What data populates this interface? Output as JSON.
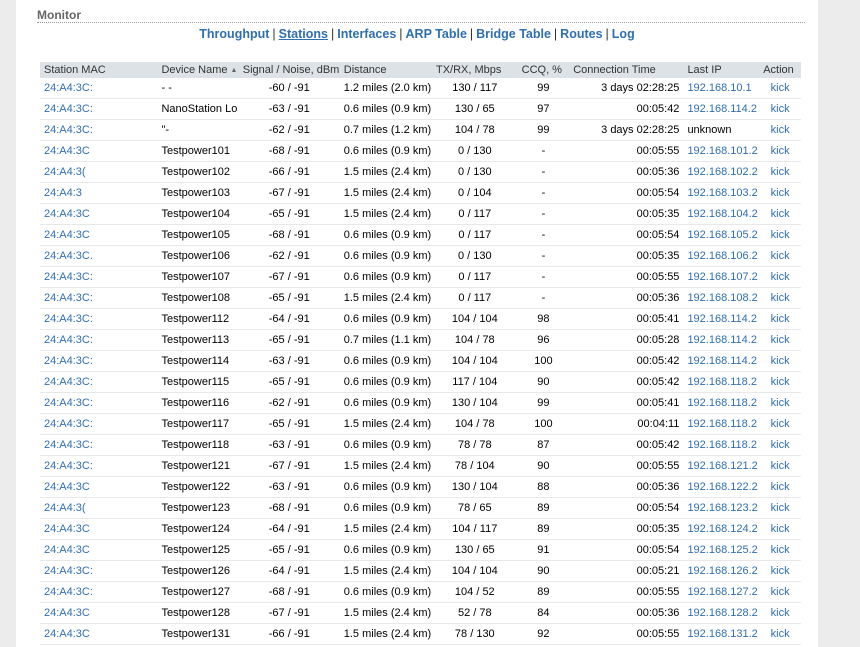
{
  "page": {
    "title": "Monitor"
  },
  "nav": [
    {
      "label": "Throughput",
      "active": false
    },
    {
      "label": "Stations",
      "active": true
    },
    {
      "label": "Interfaces",
      "active": false
    },
    {
      "label": "ARP Table",
      "active": false
    },
    {
      "label": "Bridge Table",
      "active": false
    },
    {
      "label": "Routes",
      "active": false
    },
    {
      "label": "Log",
      "active": false
    }
  ],
  "table": {
    "headers": {
      "mac": "Station MAC",
      "name": "Device Name",
      "signal": "Signal / Noise, dBm",
      "distance": "Distance",
      "txrx": "TX/RX, Mbps",
      "ccq": "CCQ, %",
      "time": "Connection Time",
      "ip": "Last IP",
      "action": "Action"
    },
    "sort_indicator": "▲",
    "rows": [
      {
        "mac": "24:A4:3C:",
        "name": "-      -",
        "signal": "-60 / -91",
        "distance": "1.2 miles (2.0 km)",
        "txrx": "130 / 117",
        "ccq": "99",
        "time": "3 days 02:28:25",
        "ip": "192.168.10.1",
        "ip_link": true,
        "action": "kick"
      },
      {
        "mac": "24:A4:3C:",
        "name": "NanoStation Lo",
        "signal": "-63 / -91",
        "distance": "0.6 miles (0.9 km)",
        "txrx": "130 / 65",
        "ccq": "97",
        "time": "00:05:42",
        "ip": "192.168.114.2",
        "ip_link": true,
        "action": "kick"
      },
      {
        "mac": "24:A4:3C:",
        "name": "\"-",
        "signal": "-62 / -91",
        "distance": "0.7 miles (1.2 km)",
        "txrx": "104 / 78",
        "ccq": "99",
        "time": "3 days 02:28:25",
        "ip": "unknown",
        "ip_link": false,
        "action": "kick"
      },
      {
        "mac": "24:A4:3C",
        "name": "Testpower101",
        "signal": "-68 / -91",
        "distance": "0.6 miles (0.9 km)",
        "txrx": "0 / 130",
        "ccq": "-",
        "time": "00:05:55",
        "ip": "192.168.101.2",
        "ip_link": true,
        "action": "kick"
      },
      {
        "mac": "24:A4:3(",
        "name": "Testpower102",
        "signal": "-66 / -91",
        "distance": "1.5 miles (2.4 km)",
        "txrx": "0 / 130",
        "ccq": "-",
        "time": "00:05:36",
        "ip": "192.168.102.2",
        "ip_link": true,
        "action": "kick"
      },
      {
        "mac": "24:A4:3",
        "name": "Testpower103",
        "signal": "-67 / -91",
        "distance": "1.5 miles (2.4 km)",
        "txrx": "0 / 104",
        "ccq": "-",
        "time": "00:05:54",
        "ip": "192.168.103.2",
        "ip_link": true,
        "action": "kick"
      },
      {
        "mac": "24:A4:3C",
        "name": "Testpower104",
        "signal": "-65 / -91",
        "distance": "1.5 miles (2.4 km)",
        "txrx": "0 / 117",
        "ccq": "-",
        "time": "00:05:35",
        "ip": "192.168.104.2",
        "ip_link": true,
        "action": "kick"
      },
      {
        "mac": "24:A4:3C",
        "name": "Testpower105",
        "signal": "-68 / -91",
        "distance": "0.6 miles (0.9 km)",
        "txrx": "0 / 117",
        "ccq": "-",
        "time": "00:05:54",
        "ip": "192.168.105.2",
        "ip_link": true,
        "action": "kick"
      },
      {
        "mac": "24:A4:3C.",
        "name": "Testpower106",
        "signal": "-62 / -91",
        "distance": "0.6 miles (0.9 km)",
        "txrx": "0 / 130",
        "ccq": "-",
        "time": "00:05:35",
        "ip": "192.168.106.2",
        "ip_link": true,
        "action": "kick"
      },
      {
        "mac": "24:A4:3C:",
        "name": "Testpower107",
        "signal": "-67 / -91",
        "distance": "0.6 miles (0.9 km)",
        "txrx": "0 / 117",
        "ccq": "-",
        "time": "00:05:55",
        "ip": "192.168.107.2",
        "ip_link": true,
        "action": "kick"
      },
      {
        "mac": "24:A4:3C:",
        "name": "Testpower108",
        "signal": "-65 / -91",
        "distance": "1.5 miles (2.4 km)",
        "txrx": "0 / 117",
        "ccq": "-",
        "time": "00:05:36",
        "ip": "192.168.108.2",
        "ip_link": true,
        "action": "kick"
      },
      {
        "mac": "24:A4:3C:",
        "name": "Testpower112",
        "signal": "-64 / -91",
        "distance": "0.6 miles (0.9 km)",
        "txrx": "104 / 104",
        "ccq": "98",
        "time": "00:05:41",
        "ip": "192.168.114.2",
        "ip_link": true,
        "action": "kick"
      },
      {
        "mac": "24:A4:3C:",
        "name": "Testpower113",
        "signal": "-65 / -91",
        "distance": "0.7 miles (1.1 km)",
        "txrx": "104 / 78",
        "ccq": "96",
        "time": "00:05:28",
        "ip": "192.168.114.2",
        "ip_link": true,
        "action": "kick"
      },
      {
        "mac": "24:A4:3C:",
        "name": "Testpower114",
        "signal": "-63 / -91",
        "distance": "0.6 miles (0.9 km)",
        "txrx": "104 / 104",
        "ccq": "100",
        "time": "00:05:42",
        "ip": "192.168.114.2",
        "ip_link": true,
        "action": "kick"
      },
      {
        "mac": "24:A4:3C:",
        "name": "Testpower115",
        "signal": "-65 / -91",
        "distance": "0.6 miles (0.9 km)",
        "txrx": "117 / 104",
        "ccq": "90",
        "time": "00:05:42",
        "ip": "192.168.118.2",
        "ip_link": true,
        "action": "kick"
      },
      {
        "mac": "24:A4:3C:",
        "name": "Testpower116",
        "signal": "-62 / -91",
        "distance": "0.6 miles (0.9 km)",
        "txrx": "130 / 104",
        "ccq": "99",
        "time": "00:05:41",
        "ip": "192.168.118.2",
        "ip_link": true,
        "action": "kick"
      },
      {
        "mac": "24:A4:3C:",
        "name": "Testpower117",
        "signal": "-65 / -91",
        "distance": "1.5 miles (2.4 km)",
        "txrx": "104 / 78",
        "ccq": "100",
        "time": "00:04:11",
        "ip": "192.168.118.2",
        "ip_link": true,
        "action": "kick"
      },
      {
        "mac": "24:A4:3C:",
        "name": "Testpower118",
        "signal": "-63 / -91",
        "distance": "0.6 miles (0.9 km)",
        "txrx": "78 / 78",
        "ccq": "87",
        "time": "00:05:42",
        "ip": "192.168.118.2",
        "ip_link": true,
        "action": "kick"
      },
      {
        "mac": "24:A4:3C:",
        "name": "Testpower121",
        "signal": "-67 / -91",
        "distance": "1.5 miles (2.4 km)",
        "txrx": "78 / 104",
        "ccq": "90",
        "time": "00:05:55",
        "ip": "192.168.121.2",
        "ip_link": true,
        "action": "kick"
      },
      {
        "mac": "24:A4:3C",
        "name": "Testpower122",
        "signal": "-63 / -91",
        "distance": "0.6 miles (0.9 km)",
        "txrx": "130 / 104",
        "ccq": "88",
        "time": "00:05:36",
        "ip": "192.168.122.2",
        "ip_link": true,
        "action": "kick"
      },
      {
        "mac": "24:A4:3(",
        "name": "Testpower123",
        "signal": "-68 / -91",
        "distance": "0.6 miles (0.9 km)",
        "txrx": "78 / 65",
        "ccq": "89",
        "time": "00:05:54",
        "ip": "192.168.123.2",
        "ip_link": true,
        "action": "kick"
      },
      {
        "mac": "24:A4:3C",
        "name": "Testpower124",
        "signal": "-64 / -91",
        "distance": "1.5 miles (2.4 km)",
        "txrx": "104 / 117",
        "ccq": "89",
        "time": "00:05:35",
        "ip": "192.168.124.2",
        "ip_link": true,
        "action": "kick"
      },
      {
        "mac": "24:A4:3C",
        "name": "Testpower125",
        "signal": "-65 / -91",
        "distance": "0.6 miles (0.9 km)",
        "txrx": "130 / 65",
        "ccq": "91",
        "time": "00:05:54",
        "ip": "192.168.125.2",
        "ip_link": true,
        "action": "kick"
      },
      {
        "mac": "24:A4:3C:",
        "name": "Testpower126",
        "signal": "-64 / -91",
        "distance": "1.5 miles (2.4 km)",
        "txrx": "104 / 104",
        "ccq": "90",
        "time": "00:05:21",
        "ip": "192.168.126.2",
        "ip_link": true,
        "action": "kick"
      },
      {
        "mac": "24:A4:3C:",
        "name": "Testpower127",
        "signal": "-68 / -91",
        "distance": "0.6 miles (0.9 km)",
        "txrx": "104 / 52",
        "ccq": "89",
        "time": "00:05:55",
        "ip": "192.168.127.2",
        "ip_link": true,
        "action": "kick"
      },
      {
        "mac": "24:A4:3C",
        "name": "Testpower128",
        "signal": "-67 / -91",
        "distance": "1.5 miles (2.4 km)",
        "txrx": "52 / 78",
        "ccq": "84",
        "time": "00:05:36",
        "ip": "192.168.128.2",
        "ip_link": true,
        "action": "kick"
      },
      {
        "mac": "24:A4:3C",
        "name": "Testpower131",
        "signal": "-66 / -91",
        "distance": "1.5 miles (2.4 km)",
        "txrx": "78 / 130",
        "ccq": "92",
        "time": "00:05:55",
        "ip": "192.168.131.2",
        "ip_link": true,
        "action": "kick"
      }
    ]
  }
}
